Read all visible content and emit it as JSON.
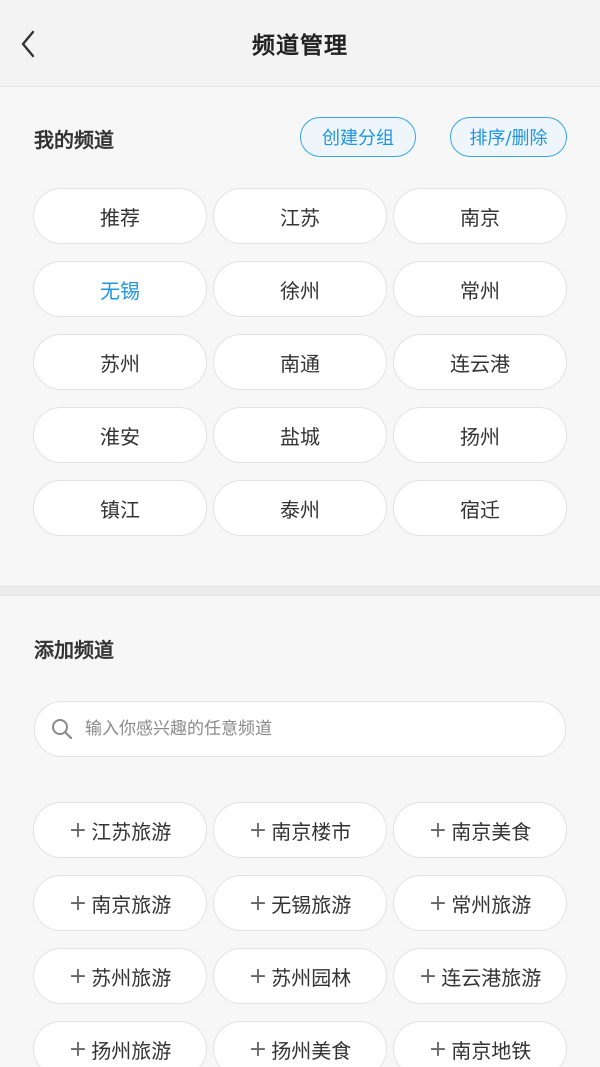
{
  "header": {
    "title": "频道管理"
  },
  "my_channels": {
    "title": "我的频道",
    "create_group_label": "创建分组",
    "sort_delete_label": "排序/删除",
    "items": [
      {
        "label": "推荐"
      },
      {
        "label": "江苏"
      },
      {
        "label": "南京"
      },
      {
        "label": "无锡",
        "selected": true
      },
      {
        "label": "徐州"
      },
      {
        "label": "常州"
      },
      {
        "label": "苏州"
      },
      {
        "label": "南通"
      },
      {
        "label": "连云港"
      },
      {
        "label": "淮安"
      },
      {
        "label": "盐城"
      },
      {
        "label": "扬州"
      },
      {
        "label": "镇江"
      },
      {
        "label": "泰州"
      },
      {
        "label": "宿迁"
      }
    ]
  },
  "add_channels": {
    "title": "添加频道",
    "search_placeholder": "输入你感兴趣的任意频道",
    "plus_symbol": "+",
    "items": [
      {
        "label": "江苏旅游"
      },
      {
        "label": "南京楼市"
      },
      {
        "label": "南京美食"
      },
      {
        "label": "南京旅游"
      },
      {
        "label": "无锡旅游"
      },
      {
        "label": "常州旅游"
      },
      {
        "label": "苏州旅游"
      },
      {
        "label": "苏州园林"
      },
      {
        "label": "连云港旅游"
      },
      {
        "label": "扬州旅游"
      },
      {
        "label": "扬州美食"
      },
      {
        "label": "南京地铁"
      }
    ]
  },
  "colors": {
    "accent": "#1f95e0",
    "text": "#333333",
    "background": "#f7f7f7"
  },
  "icons": {
    "back": "chevron-left-icon",
    "search": "search-icon"
  }
}
